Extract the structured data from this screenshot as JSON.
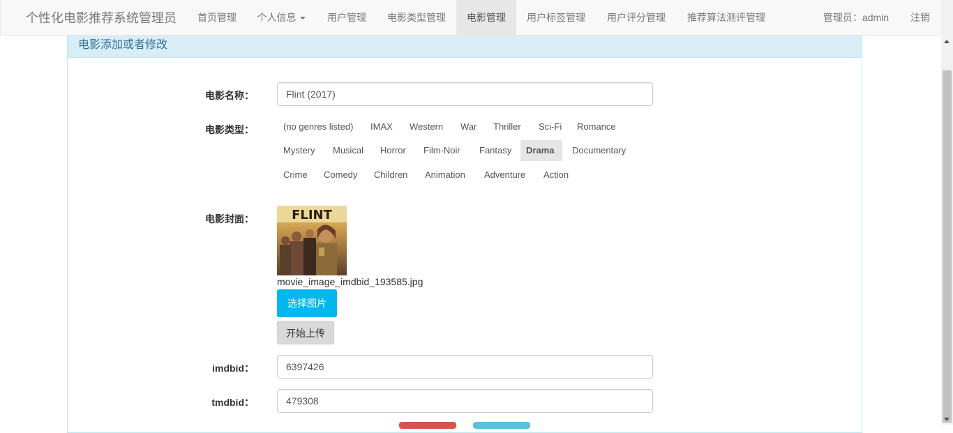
{
  "navbar": {
    "brand": "个性化电影推荐系统管理员",
    "items": [
      {
        "label": "首页管理"
      },
      {
        "label": "个人信息"
      },
      {
        "label": "用户管理"
      },
      {
        "label": "电影类型管理"
      },
      {
        "label": "电影管理"
      },
      {
        "label": "用户标签管理"
      },
      {
        "label": "用户评分管理"
      },
      {
        "label": "推荐算法测评管理"
      }
    ],
    "active_item": "电影管理",
    "admin_label": "管理员：admin",
    "logout_label": "注销"
  },
  "panel": {
    "heading": "电影添加或者修改"
  },
  "form": {
    "name_label": "电影名称：",
    "name_value": "Flint (2017)",
    "genre_label": "电影类型：",
    "genres_row1": [
      "(no genres listed)",
      "IMAX",
      "Western",
      "War",
      "Thriller",
      "Sci-Fi",
      "Romance"
    ],
    "genres_row2": [
      "Mystery",
      "Musical",
      "Horror",
      "Film-Noir",
      "Fantasy",
      "Drama",
      "Documentary"
    ],
    "genres_row3": [
      "Crime",
      "Comedy",
      "Children",
      "Animation",
      "Adventure",
      "Action"
    ],
    "selected_genre": "Drama",
    "cover_label": "电影封面：",
    "poster_title": "FLINT",
    "cover_filename": "movie_image_imdbid_193585.jpg",
    "choose_image_label": "选择图片",
    "upload_label": "开始上传",
    "imdbid_label": "imdbid：",
    "imdbid_value": "6397426",
    "tmdbid_label": "tmdbid：",
    "tmdbid_value": "479308"
  },
  "colors": {
    "panel_heading_bg": "#d9edf7",
    "panel_heading_text": "#31708f",
    "choose_button": "#00b7ee",
    "navbar_bg": "#f8f8f8",
    "active_nav_bg": "#e7e7e7"
  }
}
